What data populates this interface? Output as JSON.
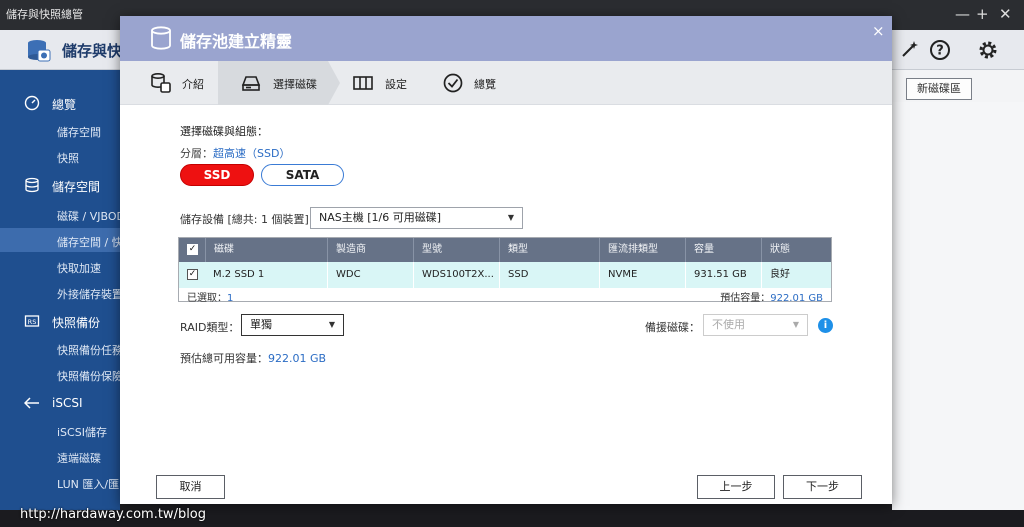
{
  "app": {
    "window_title": "儲存與快照總管",
    "name": "儲存與快",
    "toolbar_new_volume": "新磁碟區"
  },
  "sidebar": {
    "groups": [
      {
        "label": "總覽",
        "items": [
          "儲存空間",
          "快照"
        ]
      },
      {
        "label": "儲存空間",
        "items": [
          "磁碟 / VJBOD",
          "儲存空間 / 快",
          "快取加速",
          "外接儲存裝置"
        ]
      },
      {
        "label": "快照備份",
        "items": [
          "快照備份任務",
          "快照備份保險"
        ]
      },
      {
        "label": "iSCSI",
        "items": [
          "iSCSI儲存",
          "遠端磁碟",
          "LUN 匯入/匯"
        ]
      }
    ],
    "active_item": "儲存空間 / 快"
  },
  "modal": {
    "title": "儲存池建立精靈",
    "close": "×",
    "steps": [
      "介紹",
      "選擇磁碟",
      "設定",
      "總覽"
    ],
    "active_step": 1,
    "section_title": "選擇磁碟與組態：",
    "tier_label": "分層：",
    "tier_value": "超高速（SSD）",
    "pills": {
      "ssd": "SSD",
      "sata": "SATA"
    },
    "device_label": "儲存設備 [總共: 1 個裝置]:",
    "device_value": "NAS主機 [1/6 可用磁碟]",
    "table": {
      "columns": [
        "磁碟",
        "製造商",
        "型號",
        "類型",
        "匯流排類型",
        "容量",
        "狀態"
      ],
      "rows": [
        {
          "checked": "✓",
          "disk": "M.2 SSD 1",
          "vendor": "WDC",
          "model": "WDS100T2X...",
          "type": "SSD",
          "bus": "NVME",
          "capacity": "931.51 GB",
          "status": "良好"
        }
      ],
      "header_check": "✓",
      "selected_label": "已選取：",
      "selected_count": "1",
      "est_capacity_label": "預估容量：",
      "est_capacity_value": "922.01 GB"
    },
    "raid_label": "RAID類型：",
    "raid_value": "單獨",
    "spare_label": "備援磁碟：",
    "spare_value": "不使用",
    "info": "i",
    "est_usable_label": "預估總可用容量：",
    "est_usable_value": "922.01 GB",
    "buttons": {
      "cancel": "取消",
      "back": "上一步",
      "next": "下一步"
    }
  },
  "watermark": "http://hardaway.com.tw/blog"
}
